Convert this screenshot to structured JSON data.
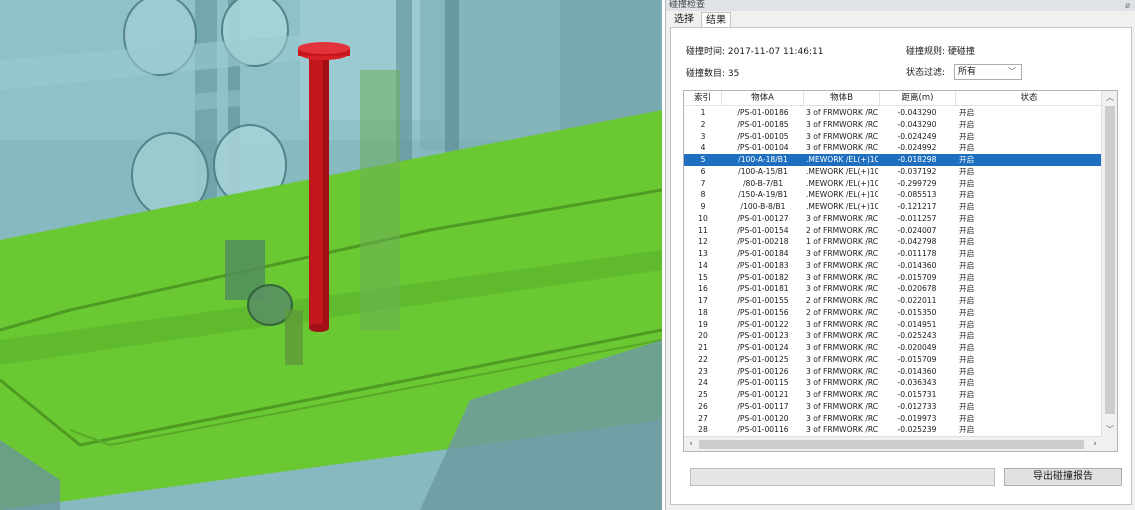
{
  "panel": {
    "title": "碰撞检查",
    "pin": "ø",
    "tabs": [
      {
        "label": "选择"
      },
      {
        "label": "结果"
      }
    ]
  },
  "info": {
    "time_label": "碰撞时间: 2017-11-07 11:46:11",
    "count_label": "碰撞数目: 35",
    "rule_label": "碰撞规则: 硬碰撞",
    "filter_label": "状态过滤:",
    "filter_value": "所有"
  },
  "table": {
    "headers": [
      "索引",
      "物体A",
      "物体B",
      "距离(m)",
      "状态"
    ],
    "rows": [
      {
        "idx": "1",
        "a": "/PS-01-00186",
        "b": "3 of FRMWORK /RC",
        "d": "-0.043290",
        "s": "开启"
      },
      {
        "idx": "2",
        "a": "/PS-01-00185",
        "b": "3 of FRMWORK /RC",
        "d": "-0.043290",
        "s": "开启"
      },
      {
        "idx": "3",
        "a": "/PS-01-00105",
        "b": "3 of FRMWORK /RC",
        "d": "-0.024249",
        "s": "开启"
      },
      {
        "idx": "4",
        "a": "/PS-01-00104",
        "b": "3 of FRMWORK /RC",
        "d": "-0.024992",
        "s": "开启"
      },
      {
        "idx": "5",
        "a": "/100-A-18/B1",
        "b": ".MEWORK /EL(+)10",
        "d": "-0.018298",
        "s": "开启"
      },
      {
        "idx": "6",
        "a": "/100-A-15/B1",
        "b": ".MEWORK /EL(+)10",
        "d": "-0.037192",
        "s": "开启"
      },
      {
        "idx": "7",
        "a": "/80-B-7/B1",
        "b": ".MEWORK /EL(+)10",
        "d": "-0.299729",
        "s": "开启"
      },
      {
        "idx": "8",
        "a": "/150-A-19/B1",
        "b": ".MEWORK /EL(+)10",
        "d": "-0.085513",
        "s": "开启"
      },
      {
        "idx": "9",
        "a": "/100-B-8/B1",
        "b": ".MEWORK /EL(+)10",
        "d": "-0.121217",
        "s": "开启"
      },
      {
        "idx": "10",
        "a": "/PS-01-00127",
        "b": "3 of FRMWORK /RC",
        "d": "-0.011257",
        "s": "开启"
      },
      {
        "idx": "11",
        "a": "/PS-01-00154",
        "b": "2 of FRMWORK /RC",
        "d": "-0.024007",
        "s": "开启"
      },
      {
        "idx": "12",
        "a": "/PS-01-00218",
        "b": "1 of FRMWORK /RC",
        "d": "-0.042798",
        "s": "开启"
      },
      {
        "idx": "13",
        "a": "/PS-01-00184",
        "b": "3 of FRMWORK /RC",
        "d": "-0.011178",
        "s": "开启"
      },
      {
        "idx": "14",
        "a": "/PS-01-00183",
        "b": "3 of FRMWORK /RC",
        "d": "-0.014360",
        "s": "开启"
      },
      {
        "idx": "15",
        "a": "/PS-01-00182",
        "b": "3 of FRMWORK /RC",
        "d": "-0.015709",
        "s": "开启"
      },
      {
        "idx": "16",
        "a": "/PS-01-00181",
        "b": "3 of FRMWORK /RC",
        "d": "-0.020678",
        "s": "开启"
      },
      {
        "idx": "17",
        "a": "/PS-01-00155",
        "b": "2 of FRMWORK /RC",
        "d": "-0.022011",
        "s": "开启"
      },
      {
        "idx": "18",
        "a": "/PS-01-00156",
        "b": "2 of FRMWORK /RC",
        "d": "-0.015350",
        "s": "开启"
      },
      {
        "idx": "19",
        "a": "/PS-01-00122",
        "b": "3 of FRMWORK /RC",
        "d": "-0.014951",
        "s": "开启"
      },
      {
        "idx": "20",
        "a": "/PS-01-00123",
        "b": "3 of FRMWORK /RC",
        "d": "-0.025243",
        "s": "开启"
      },
      {
        "idx": "21",
        "a": "/PS-01-00124",
        "b": "3 of FRMWORK /RC",
        "d": "-0.020049",
        "s": "开启"
      },
      {
        "idx": "22",
        "a": "/PS-01-00125",
        "b": "3 of FRMWORK /RC",
        "d": "-0.015709",
        "s": "开启"
      },
      {
        "idx": "23",
        "a": "/PS-01-00126",
        "b": "3 of FRMWORK /RC",
        "d": "-0.014360",
        "s": "开启"
      },
      {
        "idx": "24",
        "a": "/PS-01-00115",
        "b": "3 of FRMWORK /RC",
        "d": "-0.036343",
        "s": "开启"
      },
      {
        "idx": "25",
        "a": "/PS-01-00121",
        "b": "3 of FRMWORK /RC",
        "d": "-0.015731",
        "s": "开启"
      },
      {
        "idx": "26",
        "a": "/PS-01-00117",
        "b": "3 of FRMWORK /RC",
        "d": "-0.012733",
        "s": "开启"
      },
      {
        "idx": "27",
        "a": "/PS-01-00120",
        "b": "3 of FRMWORK /RC",
        "d": "-0.019973",
        "s": "开启"
      },
      {
        "idx": "28",
        "a": "/PS-01-00116",
        "b": "3 of FRMWORK /RC",
        "d": "-0.025239",
        "s": "开启"
      }
    ],
    "selected_index": "5"
  },
  "buttons": {
    "export_label": "导出碰撞报告"
  },
  "icons": {
    "filter_dropdown": "chevron-down-icon",
    "scroll_up": "chevron-up-icon",
    "scroll_down": "chevron-down-icon",
    "scroll_left": "chevron-left-icon",
    "scroll_right": "chevron-right-icon"
  },
  "colors": {
    "selection": "#1e6fbf",
    "floor_green": "#6ac832",
    "clash_red": "#c0161c"
  }
}
